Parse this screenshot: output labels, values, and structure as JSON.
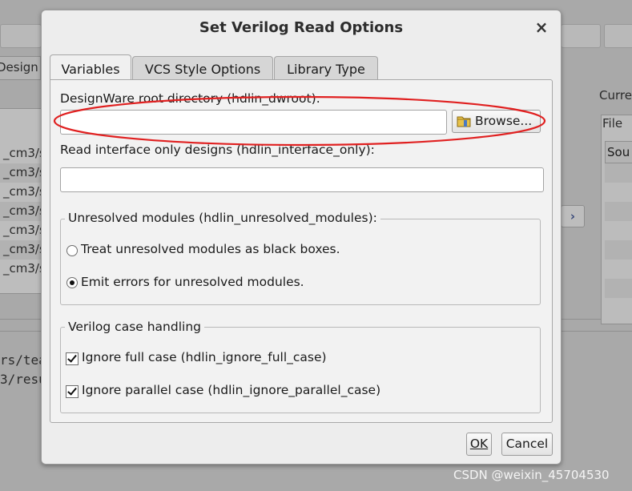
{
  "background": {
    "tab_label": "Design",
    "list_rows": [
      "_cm3/s",
      "_cm3/s",
      "_cm3/s",
      "_cm3/s",
      "_cm3/s",
      "_cm3/s",
      "_cm3/s"
    ],
    "console_lines": [
      "rs/tea",
      "3/resu"
    ],
    "right_label": "Curre",
    "right_tab": "File",
    "right_column": "Sou",
    "arrow_glyph": "›"
  },
  "dialog": {
    "title": "Set Verilog Read Options",
    "close_glyph": "×",
    "tabs": [
      {
        "label": "Variables",
        "active": true
      },
      {
        "label": "VCS Style Options",
        "active": false
      },
      {
        "label": "Library Type",
        "active": false
      }
    ],
    "designware": {
      "label": "DesignWare root directory  (hdlin_dwroot):",
      "value": "",
      "browse_label": "Browse..."
    },
    "interface_only": {
      "label": "Read interface only designs (hdlin_interface_only):",
      "value": ""
    },
    "unresolved": {
      "title": "Unresolved modules (hdlin_unresolved_modules):",
      "options": [
        {
          "label": "Treat unresolved modules as black boxes.",
          "selected": false
        },
        {
          "label": "Emit errors for unresolved modules.",
          "selected": true
        }
      ]
    },
    "case_handling": {
      "title": "Verilog case handling",
      "options": [
        {
          "label": "Ignore full case (hdlin_ignore_full_case)",
          "checked": true
        },
        {
          "label": "Ignore parallel case (hdlin_ignore_parallel_case)",
          "checked": true
        }
      ]
    },
    "buttons": {
      "ok": "OK",
      "cancel": "Cancel"
    }
  },
  "annotation_color": "#e02020",
  "watermark": "CSDN @weixin_45704530"
}
